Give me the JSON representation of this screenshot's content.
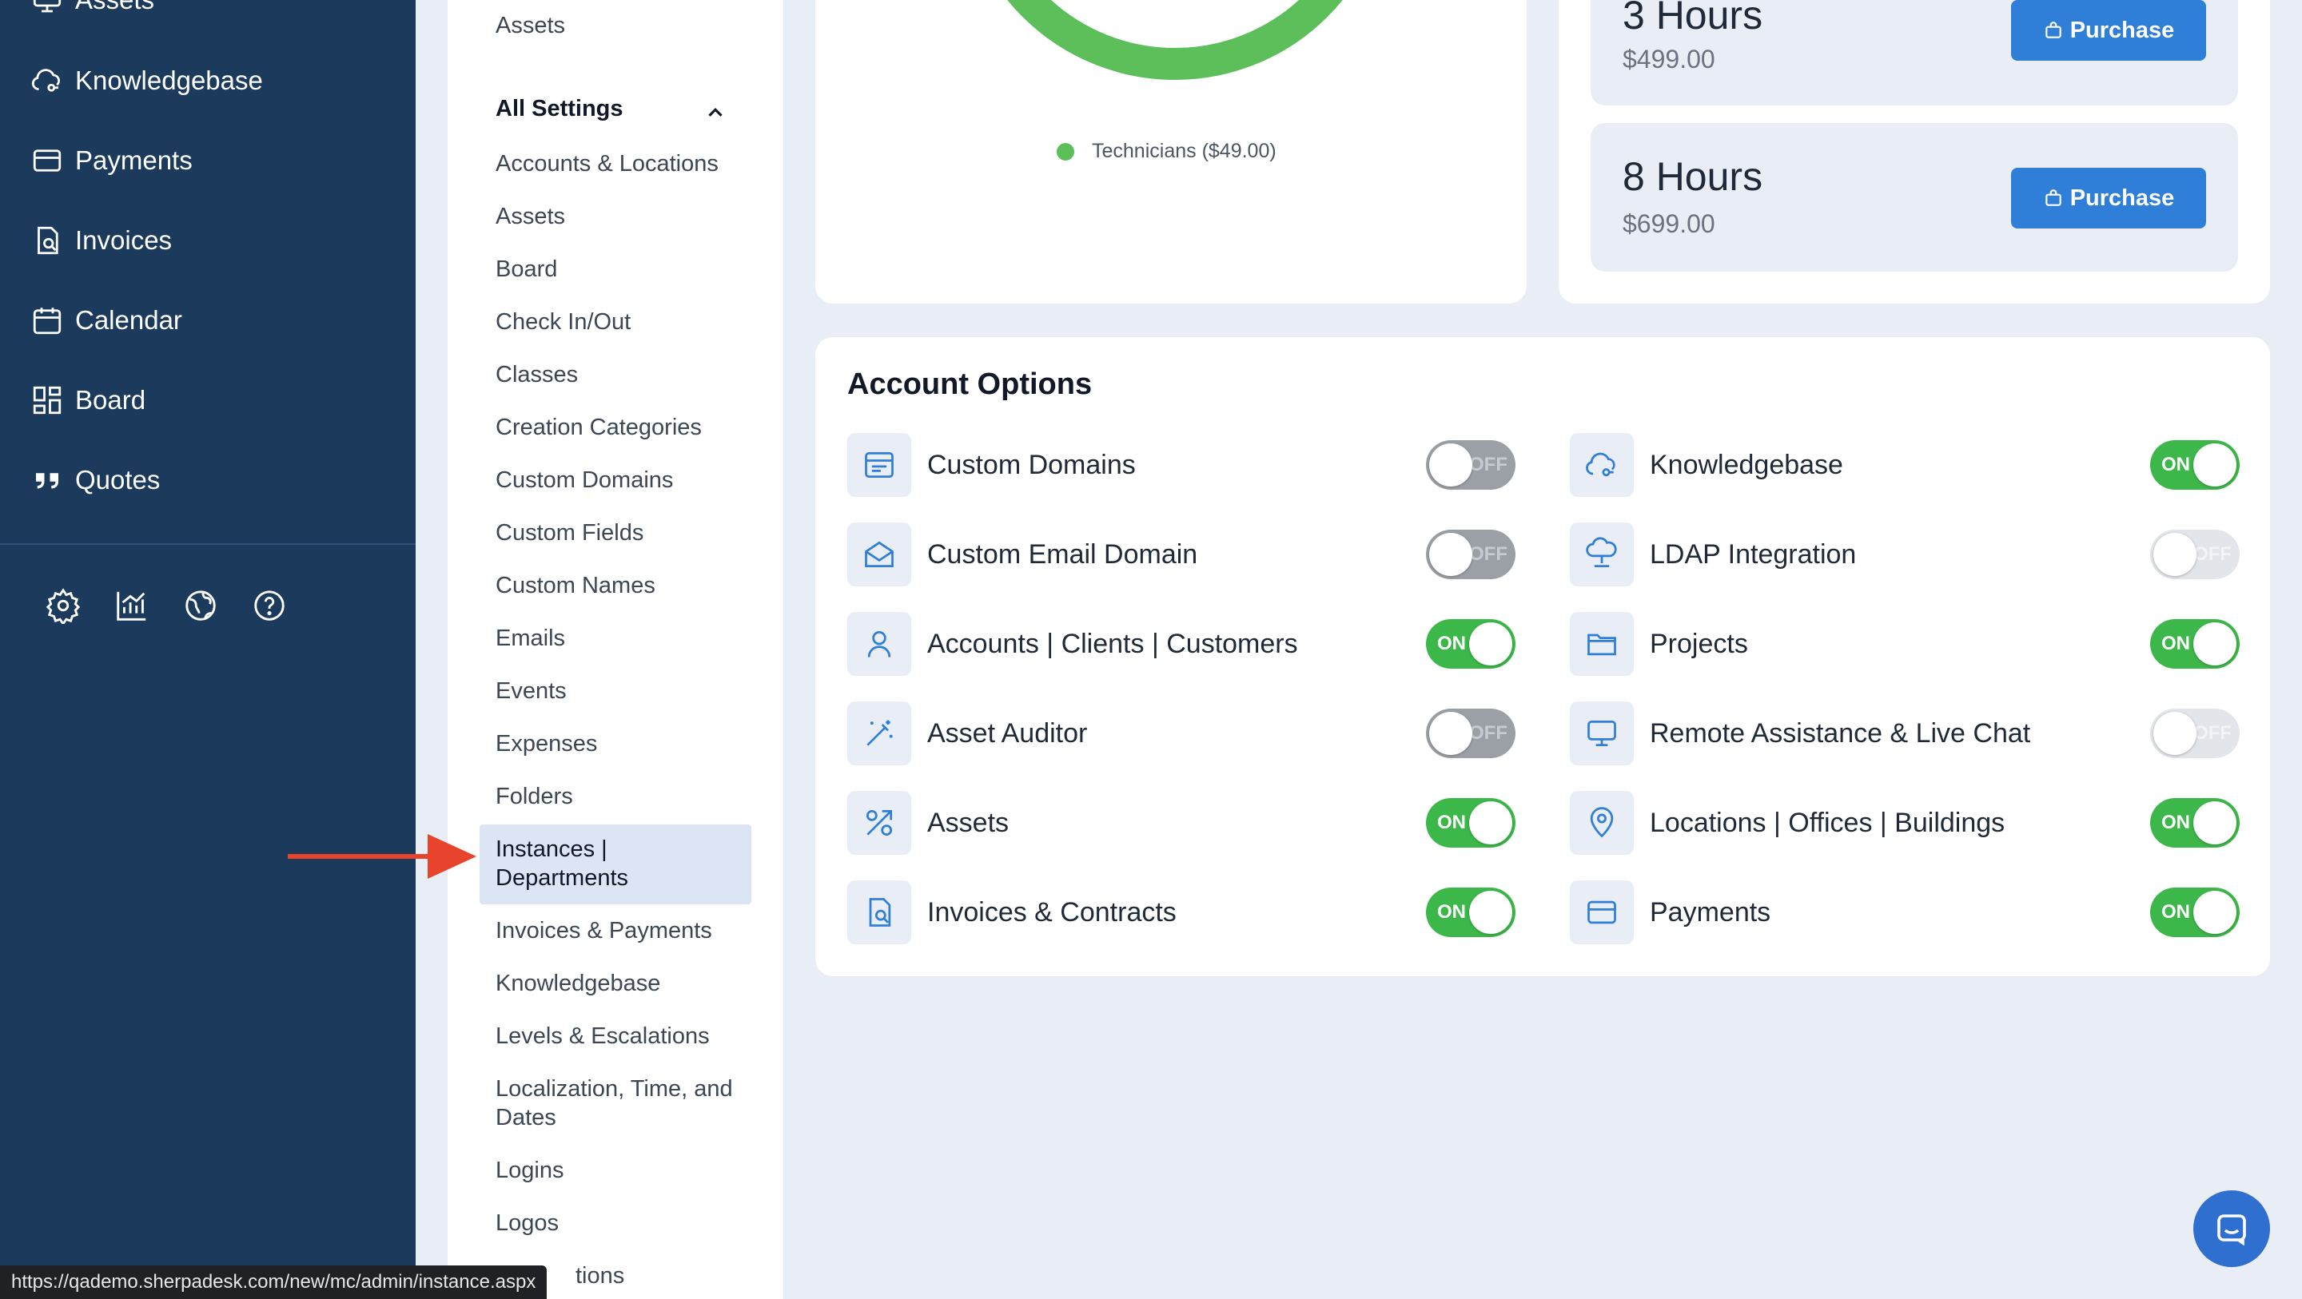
{
  "sidebar": {
    "items": [
      {
        "label": "Assets",
        "icon": "monitor-icon"
      },
      {
        "label": "Knowledgebase",
        "icon": "knowledge-icon"
      },
      {
        "label": "Payments",
        "icon": "credit-card-icon"
      },
      {
        "label": "Invoices",
        "icon": "invoice-icon"
      },
      {
        "label": "Calendar",
        "icon": "calendar-icon"
      },
      {
        "label": "Board",
        "icon": "board-icon"
      },
      {
        "label": "Quotes",
        "icon": "quote-icon"
      }
    ],
    "utility_icons": [
      "gear-icon",
      "chart-icon",
      "globe-icon",
      "help-icon"
    ]
  },
  "settings_nav": {
    "top_item": "Assets",
    "header": "All Settings",
    "items": [
      "Accounts & Locations",
      "Assets",
      "Board",
      "Check In/Out",
      "Classes",
      "Creation Categories",
      "Custom Domains",
      "Custom Fields",
      "Custom Names",
      "Emails",
      "Events",
      "Expenses",
      "Folders",
      "Instances | Departments",
      "Invoices & Payments",
      "Knowledgebase",
      "Levels & Escalations",
      "Localization, Time, and Dates",
      "Logins",
      "Logos",
      "tions"
    ],
    "active": "Instances | Departments"
  },
  "chart": {
    "legend": "Technicians ($49.00)",
    "color": "#5cbf5a"
  },
  "hours": [
    {
      "title": "3 Hours",
      "price": "$499.00",
      "button": "Purchase"
    },
    {
      "title": "8 Hours",
      "price": "$699.00",
      "button": "Purchase"
    }
  ],
  "account_options": {
    "title": "Account Options",
    "left": [
      {
        "label": "Custom Domains",
        "state": "OFF",
        "icon": "domain-icon"
      },
      {
        "label": "Custom Email Domain",
        "state": "OFF",
        "icon": "envelope-open-icon"
      },
      {
        "label": "Accounts | Clients | Customers",
        "state": "ON",
        "icon": "user-icon"
      },
      {
        "label": "Asset Auditor",
        "state": "OFF",
        "icon": "magic-wand-icon"
      },
      {
        "label": "Assets",
        "state": "ON",
        "icon": "asset-icon"
      },
      {
        "label": "Invoices & Contracts",
        "state": "ON",
        "icon": "invoice-search-icon"
      }
    ],
    "right": [
      {
        "label": "Knowledgebase",
        "state": "ON",
        "icon": "knowledge-icon"
      },
      {
        "label": "LDAP Integration",
        "state": "OFF",
        "disabled": true,
        "icon": "network-icon"
      },
      {
        "label": "Projects",
        "state": "ON",
        "icon": "folder-icon"
      },
      {
        "label": "Remote Assistance & Live Chat",
        "state": "OFF",
        "disabled": true,
        "icon": "monitor-icon"
      },
      {
        "label": "Locations | Offices | Buildings",
        "state": "ON",
        "icon": "location-pin-icon"
      },
      {
        "label": "Payments",
        "state": "ON",
        "icon": "credit-card-icon"
      }
    ]
  },
  "status_url": "https://qademo.sherpadesk.com/new/mc/admin/instance.aspx",
  "colors": {
    "sidebar": "#1b3a5c",
    "accent": "#2f7fd9",
    "toggle_on": "#3cb84a",
    "annotation_arrow": "#e8432d"
  }
}
